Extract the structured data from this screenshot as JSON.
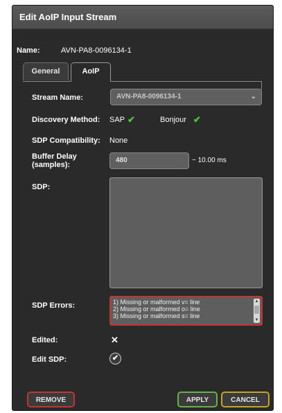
{
  "window": {
    "title": "Edit AoIP Input Stream"
  },
  "name": {
    "label": "Name:",
    "value": "AVN-PA8-0096134-1"
  },
  "tabs": [
    {
      "label": "General",
      "active": false
    },
    {
      "label": "AoIP",
      "active": true
    }
  ],
  "form": {
    "stream_name": {
      "label": "Stream Name:",
      "value": "AVN-PA8-0096134-1"
    },
    "discovery": {
      "label": "Discovery Method:",
      "sap": "SAP",
      "bonjour": "Bonjour"
    },
    "sdp_compat": {
      "label": "SDP Compatibility:",
      "value": "None"
    },
    "buffer_delay": {
      "label_line1": "Buffer Delay",
      "label_line2": "(samples):",
      "value": "480",
      "suffix": "~ 10.00 ms"
    },
    "sdp": {
      "label": "SDP:",
      "value": ""
    },
    "sdp_errors": {
      "label": "SDP Errors:",
      "lines": [
        "1) Missing or malformed v= line",
        "2) Missing or malformed o= line",
        "3) Missing or malformed s= line"
      ]
    },
    "edited": {
      "label": "Edited:"
    },
    "edit_sdp": {
      "label": "Edit SDP:"
    }
  },
  "buttons": {
    "remove": "REMOVE",
    "apply": "APPLY",
    "cancel": "CANCEL"
  },
  "icons": {
    "check": "✔",
    "x": "✕",
    "chevron": "⌄"
  },
  "colors": {
    "accent_red": "#c8342d",
    "accent_green": "#67b347",
    "accent_yellow": "#c9a326",
    "check_green": "#4cc93c"
  }
}
